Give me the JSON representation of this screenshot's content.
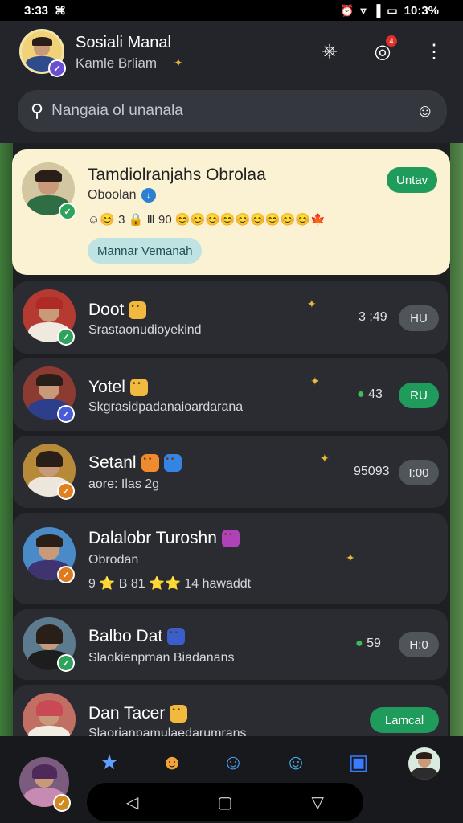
{
  "status_bar": {
    "time": "3:33",
    "battery_pct": "10:3%"
  },
  "header": {
    "title": "Sosiali Manal",
    "subtitle": "Kamle Brliam"
  },
  "search": {
    "placeholder": "Nangaia ol unanala"
  },
  "featured": {
    "name": "Tamdiolranjahs Obrolaa",
    "status": "Oboolan",
    "emoji_line": "☺😊 3 🔒 Ⅲ 90 😊😊😊😊😊😊😊😊😊🍁",
    "action_label": "Untav",
    "tag_label": "Mannar Vemanah"
  },
  "chats": [
    {
      "name": "Doot",
      "preview": "Srastaonudioyekind",
      "time": "3 :49",
      "pill": "HU",
      "pill_style": "grey",
      "avatar_bg": "#b53a32",
      "badge_color": "#2ea35b"
    },
    {
      "name": "Yotel",
      "preview": "Skgrasidpadanaioardarana",
      "time": "43",
      "pill": "RU",
      "pill_style": "green",
      "avatar_bg": "#8c3b32",
      "badge_color": "#4a5bd8"
    },
    {
      "name": "Setanl",
      "preview": "aore: Ilas 2g",
      "time": "95093",
      "pill": "I:00",
      "pill_style": "grey",
      "avatar_bg": "#b78a3a",
      "badge_color": "#e0801f"
    },
    {
      "name": "Dalalobr Turoshn",
      "preview": "Obrodan",
      "preview2": "9 ⭐ B 81 ⭐⭐ 14 hawaddt",
      "time": "",
      "pill": "",
      "pill_style": "",
      "avatar_bg": "#4a8ac6",
      "badge_color": "#e07a1f"
    },
    {
      "name": "Balbo Dat",
      "preview": "Slaokienpman Biadanans",
      "time": "59",
      "pill": "H:0",
      "pill_style": "grey",
      "avatar_bg": "#5d7b8e",
      "badge_color": "#2ea35b"
    },
    {
      "name": "Dan Tacer",
      "preview": "Slaorianpamulaedarumrans",
      "time": "",
      "pill": "Lamcal",
      "pill_style": "green",
      "avatar_bg": "#c26f63",
      "badge_color": ""
    }
  ]
}
